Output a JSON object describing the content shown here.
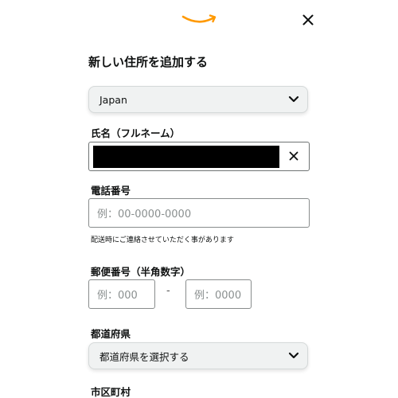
{
  "header": {
    "logo_icon": "amazon-smile-logo",
    "close_icon": "close-icon",
    "accent_color": "#ff9900"
  },
  "page_title": "新しい住所を追加する",
  "country": {
    "selected": "Japan",
    "icon": "chevron-down-icon"
  },
  "name_field": {
    "label": "氏名（フルネーム）",
    "value_redacted": true,
    "clear_icon": "close-icon"
  },
  "phone_field": {
    "label": "電話番号",
    "placeholder": "例：00-0000-0000",
    "hint": "配送時にご連絡させていただく事があります"
  },
  "postal_field": {
    "label": "郵便番号（半角数字）",
    "placeholder_1": "例：000",
    "separator": "-",
    "placeholder_2": "例：0000"
  },
  "prefecture_field": {
    "label": "都道府県",
    "selected": "都道府県を選択する",
    "icon": "chevron-down-icon"
  },
  "city_field": {
    "label": "市区町村"
  }
}
